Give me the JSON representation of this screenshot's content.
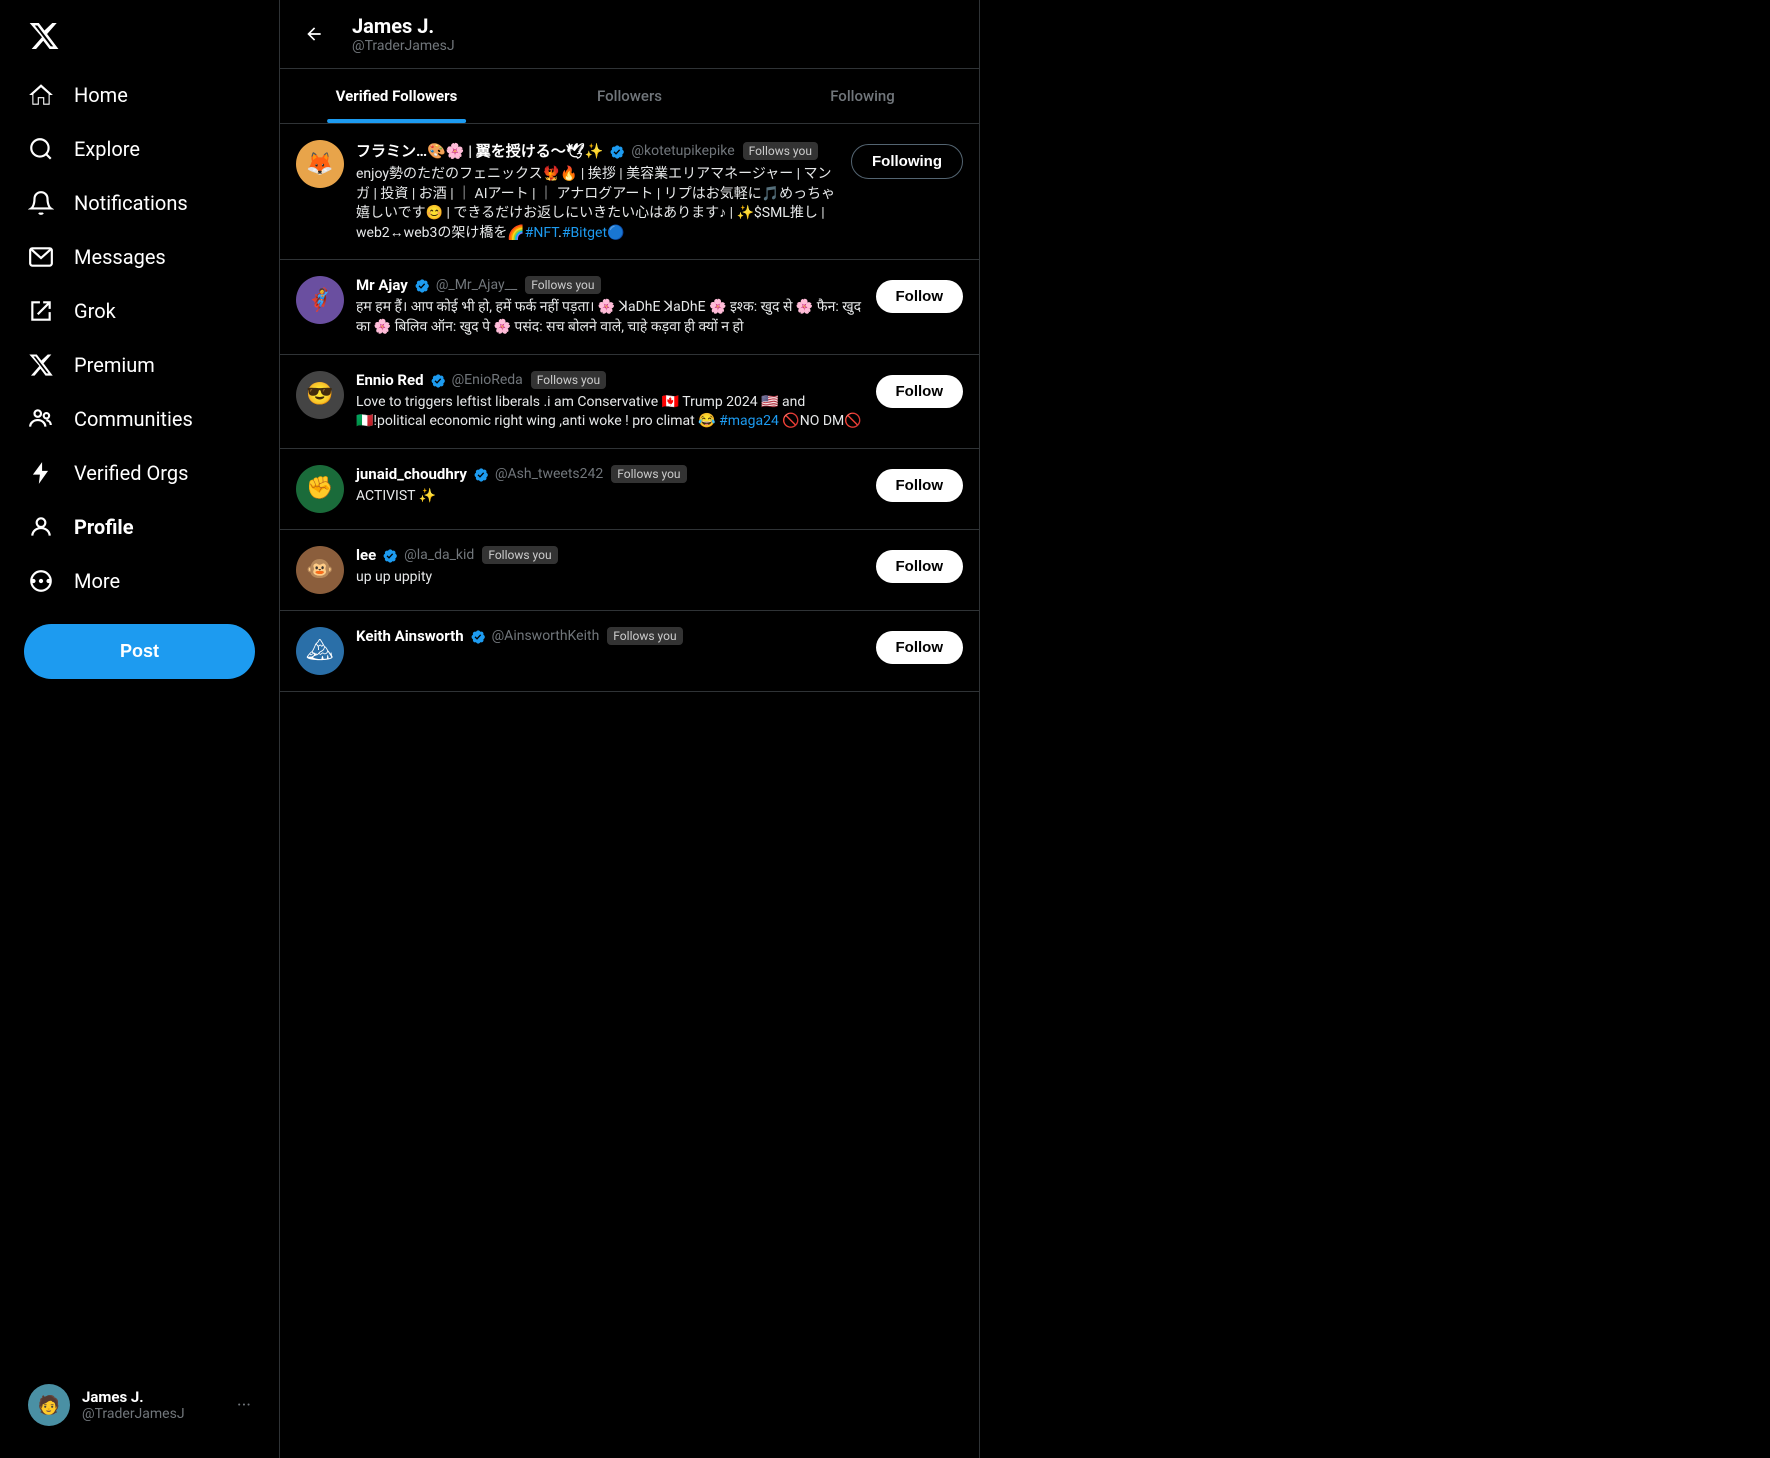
{
  "sidebar": {
    "logo_label": "X",
    "nav_items": [
      {
        "id": "home",
        "label": "Home",
        "icon": "home"
      },
      {
        "id": "explore",
        "label": "Explore",
        "icon": "explore"
      },
      {
        "id": "notifications",
        "label": "Notifications",
        "icon": "bell"
      },
      {
        "id": "messages",
        "label": "Messages",
        "icon": "mail"
      },
      {
        "id": "grok",
        "label": "Grok",
        "icon": "grok"
      },
      {
        "id": "premium",
        "label": "Premium",
        "icon": "x"
      },
      {
        "id": "communities",
        "label": "Communities",
        "icon": "communities"
      },
      {
        "id": "verified_orgs",
        "label": "Verified Orgs",
        "icon": "bolt"
      },
      {
        "id": "profile",
        "label": "Profile",
        "icon": "person"
      },
      {
        "id": "more",
        "label": "More",
        "icon": "more"
      }
    ],
    "post_button_label": "Post",
    "profile": {
      "name": "James J.",
      "handle": "@TraderJamesJ"
    }
  },
  "header": {
    "back_label": "←",
    "name": "James J.",
    "handle": "@TraderJamesJ"
  },
  "tabs": [
    {
      "id": "verified_followers",
      "label": "Verified Followers",
      "active": true
    },
    {
      "id": "followers",
      "label": "Followers",
      "active": false
    },
    {
      "id": "following",
      "label": "Following",
      "active": false
    }
  ],
  "followers": [
    {
      "id": 1,
      "avatar_emoji": "🦊",
      "avatar_color": "#e8a44a",
      "name": "フラミン…🎨🌸 | 翼を授ける～🕊✨",
      "verified": true,
      "handle": "@kotetupikepike",
      "follows_you": true,
      "bio": "enjoy勢のただのフェニックス🐦‍🔥🔥 | 挨拶 | 美容業エリアマネージャー | マンガ | 投資 | お酒 | ｜ AIアート | ｜ アナログアート | リプはお気軽に🎵めっちゃ嬉しいです😊 | できるだけお返しにいきたい心はあります♪ | ✨$SML推し | web2↔web3の架け橋を🌈#NFT.#Bitget🔵",
      "button_type": "following",
      "button_label": "Following"
    },
    {
      "id": 2,
      "avatar_emoji": "🦸",
      "avatar_color": "#6a4fa0",
      "name": "Mr Ajay",
      "verified": true,
      "handle": "@_Mr_Ajay__",
      "follows_you": true,
      "bio": "हम हम हैं। आप कोई भी हो, हमें फर्क नहीं पड़ता। 🌸 ꓘaDhE ꓘaDhE 🌸 इश्क: खुद से 🌸 फैन: खुद का 🌸 बिलिव ऑन: खुद पे 🌸 पसंद: सच बोलने वाले, चाहे कड़वा ही क्यों न हो",
      "button_type": "follow",
      "button_label": "Follow"
    },
    {
      "id": 3,
      "avatar_emoji": "😎",
      "avatar_color": "#444",
      "name": "Ennio Red",
      "verified": true,
      "handle": "@EnioReda",
      "follows_you": true,
      "bio": "Love to triggers leftist liberals .i am Conservative 🇨🇦 Trump 2024 🇺🇸 and 🇮🇹!political economic right wing ,anti woke ! pro climat 😂 #maga24 🚫NO DM🚫",
      "button_type": "follow",
      "button_label": "Follow"
    },
    {
      "id": 4,
      "avatar_emoji": "✊",
      "avatar_color": "#1a6b3a",
      "name": "junaid_choudhry",
      "verified": true,
      "handle": "@Ash_tweets242",
      "follows_you": true,
      "bio": "ACTIVIST ✨",
      "button_type": "follow",
      "button_label": "Follow"
    },
    {
      "id": 5,
      "avatar_emoji": "🐵",
      "avatar_color": "#8b5e3c",
      "name": "lee",
      "verified": true,
      "handle": "@la_da_kid",
      "follows_you": true,
      "bio": "up up uppity",
      "button_type": "follow",
      "button_label": "Follow"
    },
    {
      "id": 6,
      "avatar_emoji": "🏔",
      "avatar_color": "#2a6fa8",
      "name": "Keith Ainsworth",
      "verified": true,
      "handle": "@AinsworthKeith",
      "follows_you": true,
      "bio": "",
      "button_type": "follow",
      "button_label": "Follow"
    }
  ]
}
